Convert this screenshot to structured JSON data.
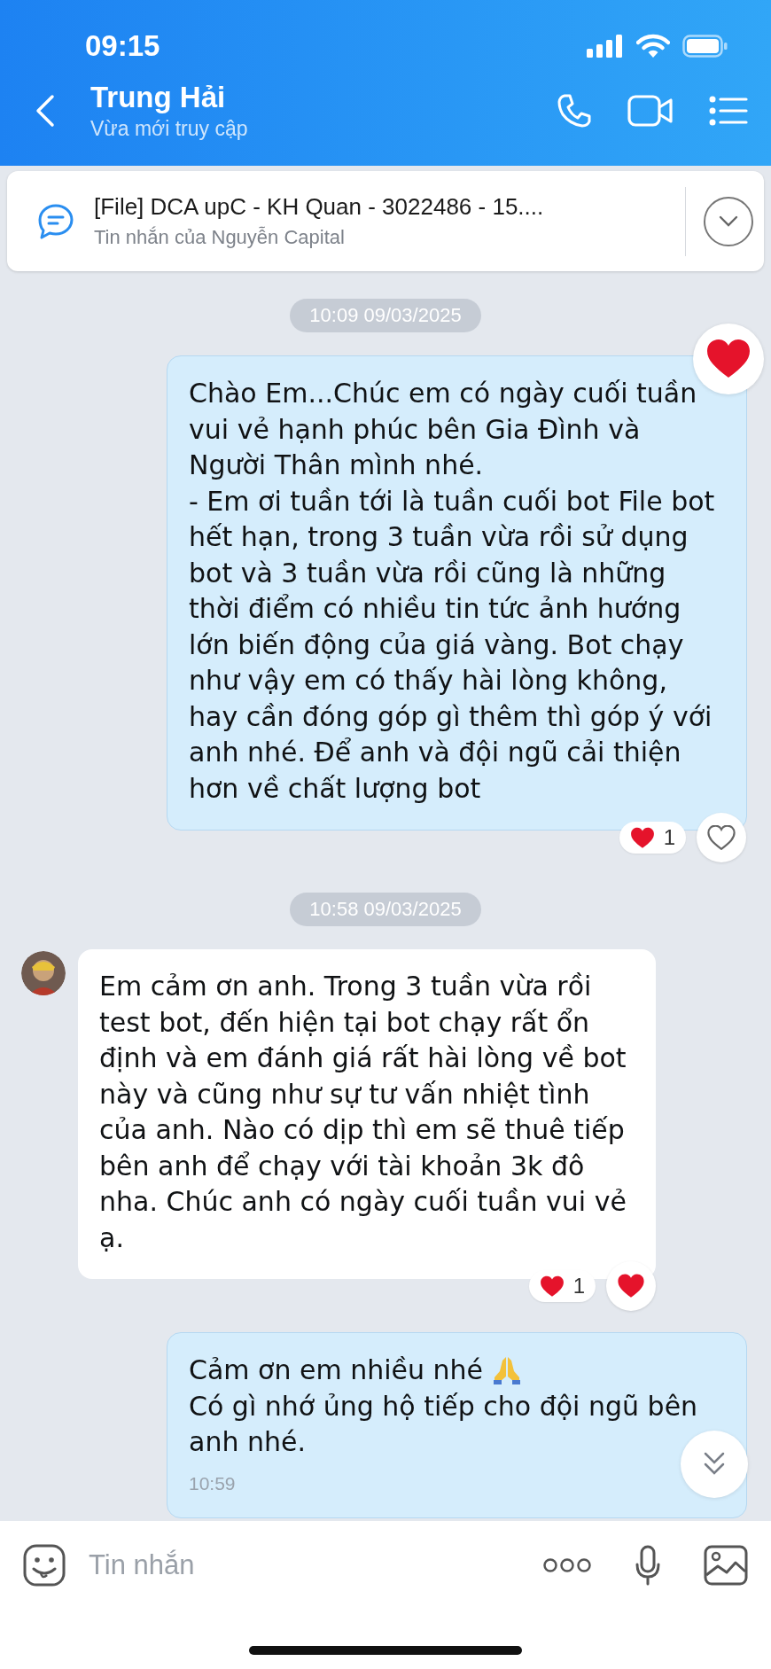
{
  "status_bar": {
    "time": "09:15"
  },
  "header": {
    "title": "Trung Hải",
    "subtitle": "Vừa mới truy cập"
  },
  "pinned": {
    "title": "[File] DCA upC - KH Quan - 3022486 - 15....",
    "subtitle": "Tin nhắn của Nguyễn Capital"
  },
  "messages": [
    {
      "kind": "date",
      "text": "10:09 09/03/2025"
    },
    {
      "kind": "sent",
      "text": "Chào Em...Chúc em có ngày cuối tuần vui vẻ hạnh phúc bên Gia Đình và Người Thân mình nhé.\n- Em ơi tuần tới là tuần cuối bot File bot hết hạn, trong 3 tuần vừa rồi sử dụng bot và 3 tuần vừa rồi cũng là những thời điểm có nhiều tin tức ảnh hướng lớn biến động của giá vàng. Bot chạy như vậy em có thấy hài lòng không, hay cần đóng góp gì thêm thì góp ý với anh nhé. Để anh và đội ngũ cải thiện hơn về chất lượng bot",
      "big_heart": true,
      "reaction_count": "1",
      "liked": false
    },
    {
      "kind": "date",
      "text": "10:58 09/03/2025"
    },
    {
      "kind": "received",
      "text": "Em cảm ơn anh. Trong 3 tuần vừa rồi test bot, đến hiện tại bot chạy rất ổn định và em đánh giá rất hài lòng về bot này và cũng như sự tư vấn nhiệt tình của anh. Nào có dịp thì em sẽ thuê tiếp bên anh để chạy với tài khoản 3k đô nha. Chúc anh có ngày cuối tuần vui vẻ ạ.",
      "reaction_count": "1",
      "liked": true
    },
    {
      "kind": "sent",
      "text": "Cảm ơn em nhiều nhé",
      "emoji": true,
      "text2": "Có gì nhớ ủng hộ tiếp cho đội ngũ bên anh nhé.",
      "time": "10:59"
    }
  ],
  "composer": {
    "placeholder": "Tin nhắn"
  }
}
